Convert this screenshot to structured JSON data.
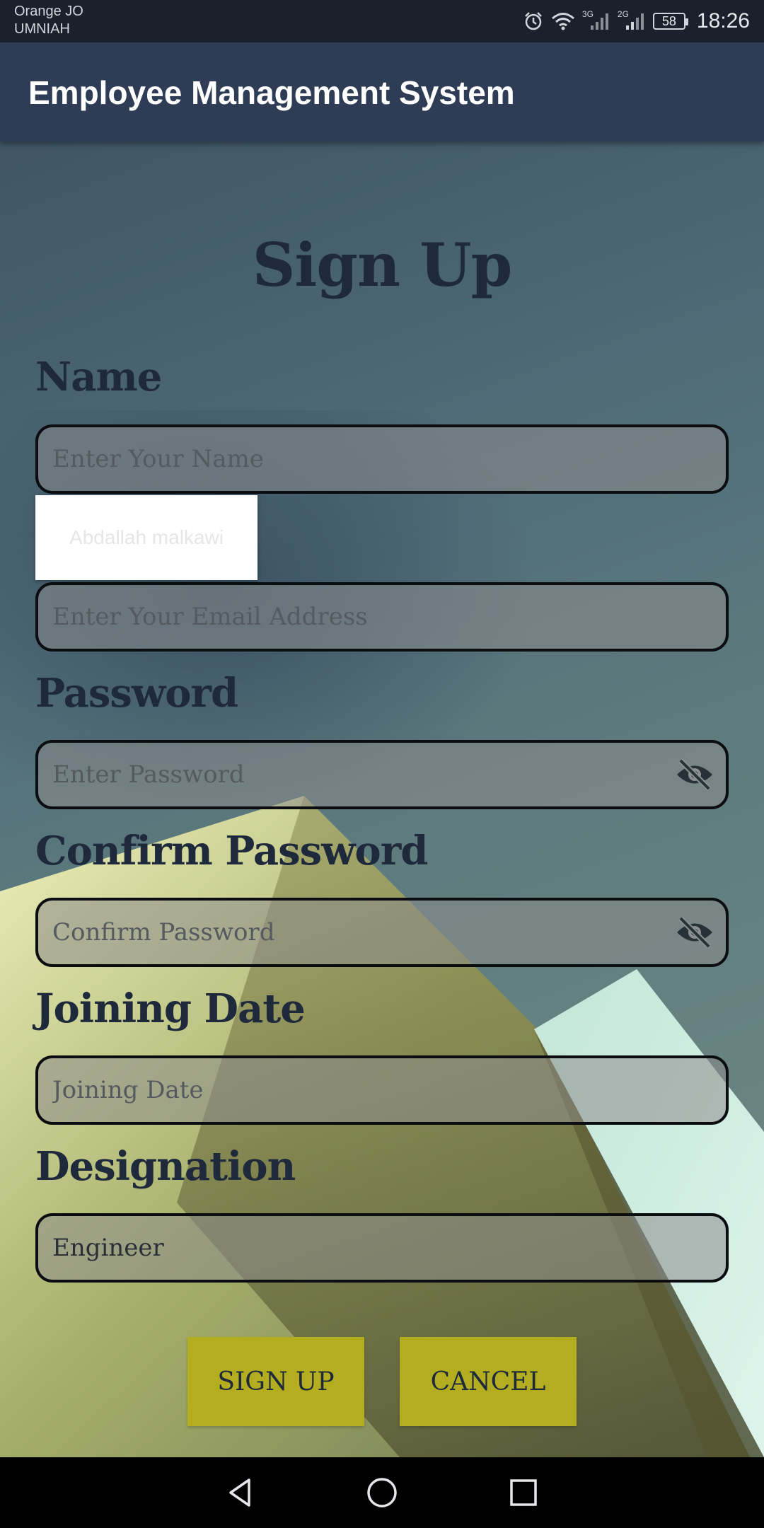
{
  "status_bar": {
    "carrier_line1": "Orange JO",
    "carrier_line2": "UMNIAH",
    "network1": "3G",
    "network2": "2G",
    "battery": "58",
    "time": "18:26",
    "icons": [
      "alarm-icon",
      "wifi-icon",
      "signal-icon",
      "signal-icon",
      "battery-icon"
    ]
  },
  "app_bar": {
    "title": "Employee Management System"
  },
  "form": {
    "heading": "Sign Up",
    "name": {
      "label": "Name",
      "placeholder": "Enter Your Name",
      "value": ""
    },
    "autofill_suggestion": "Abdallah malkawi",
    "email": {
      "placeholder": "Enter Your Email Address",
      "value": ""
    },
    "password": {
      "label": "Password",
      "placeholder": "Enter Password",
      "value": "",
      "icon": "visibility-off-icon"
    },
    "confirm_password": {
      "label": "Confirm Password",
      "placeholder": "Confirm Password",
      "value": "",
      "icon": "visibility-off-icon"
    },
    "joining_date": {
      "label": "Joining Date",
      "placeholder": "Joining Date",
      "value": ""
    },
    "designation": {
      "label": "Designation",
      "value": "Engineer"
    }
  },
  "buttons": {
    "sign_up": "SIGN UP",
    "cancel": "CANCEL"
  },
  "nav_bar": {
    "icons": [
      "back-icon",
      "home-icon",
      "recents-icon"
    ]
  },
  "colors": {
    "app_bar": "#2e3d55",
    "button": "#b3ad1f",
    "text_dark": "#1e293b"
  }
}
